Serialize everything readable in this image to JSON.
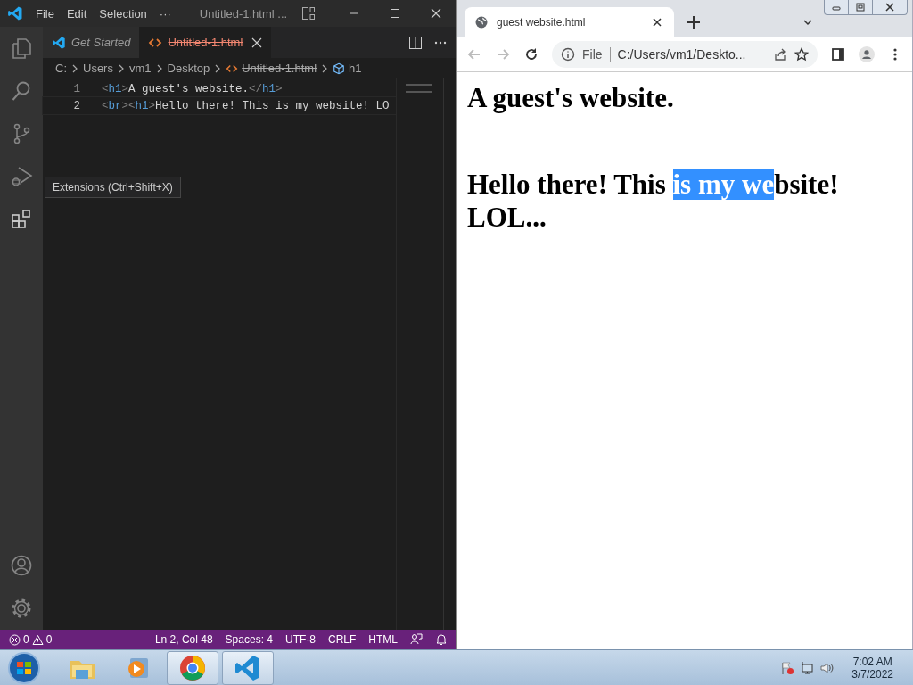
{
  "vscode": {
    "menu": [
      "File",
      "Edit",
      "Selection",
      "···"
    ],
    "title": "Untitled-1.html ...",
    "tabs": [
      {
        "label": "Get Started",
        "kind": "welcome",
        "selected": false,
        "deleted": false
      },
      {
        "label": "Untitled-1.html",
        "kind": "html",
        "selected": true,
        "deleted": true
      }
    ],
    "breadcrumbs": [
      {
        "label": "C:",
        "kind": "folder",
        "deleted": false
      },
      {
        "label": "Users",
        "kind": "folder",
        "deleted": false
      },
      {
        "label": "vm1",
        "kind": "folder",
        "deleted": false
      },
      {
        "label": "Desktop",
        "kind": "folder",
        "deleted": false
      },
      {
        "label": "Untitled-1.html",
        "kind": "file",
        "deleted": true
      },
      {
        "label": "h1",
        "kind": "symbol",
        "deleted": false
      }
    ],
    "lines": [
      {
        "number": "1",
        "current": false,
        "tokens": [
          {
            "kind": "bracket",
            "text": "<"
          },
          {
            "kind": "tag",
            "text": "h1"
          },
          {
            "kind": "bracket",
            "text": ">"
          },
          {
            "kind": "text",
            "text": "A guest's website."
          },
          {
            "kind": "bracket",
            "text": "</"
          },
          {
            "kind": "tag",
            "text": "h1"
          },
          {
            "kind": "bracket",
            "text": ">"
          }
        ]
      },
      {
        "number": "2",
        "current": true,
        "tokens": [
          {
            "kind": "bracket",
            "text": "<"
          },
          {
            "kind": "tag",
            "text": "br"
          },
          {
            "kind": "bracket",
            "text": "><"
          },
          {
            "kind": "tag",
            "text": "h1"
          },
          {
            "kind": "bracket",
            "text": ">"
          },
          {
            "kind": "text",
            "text": "Hello there! This is my website! LO"
          }
        ]
      }
    ],
    "tooltip": "Extensions (Ctrl+Shift+X)",
    "status": {
      "errors": "0",
      "warnings": "0",
      "items": [
        "Ln 2, Col 48",
        "Spaces: 4",
        "UTF-8",
        "CRLF",
        "HTML"
      ]
    }
  },
  "browser": {
    "tab": "guest website.html",
    "scheme": "File",
    "address": "C:/Users/vm1/Deskto...",
    "headings": [
      {
        "segments": [
          {
            "text": "A guest's website.",
            "selected": false
          }
        ]
      },
      {
        "segments": [
          {
            "text": "Hello there! This ",
            "selected": false
          },
          {
            "text": "is my we",
            "selected": true
          },
          {
            "text": "bsite! LOL...",
            "selected": false
          }
        ]
      }
    ]
  },
  "taskbar": {
    "apps": [
      {
        "kind": "explorer",
        "running": false
      },
      {
        "kind": "media",
        "running": false
      },
      {
        "kind": "chrome",
        "running": true
      },
      {
        "kind": "vscode",
        "running": true
      }
    ],
    "time": "7:02 AM",
    "date": "3/7/2022"
  }
}
